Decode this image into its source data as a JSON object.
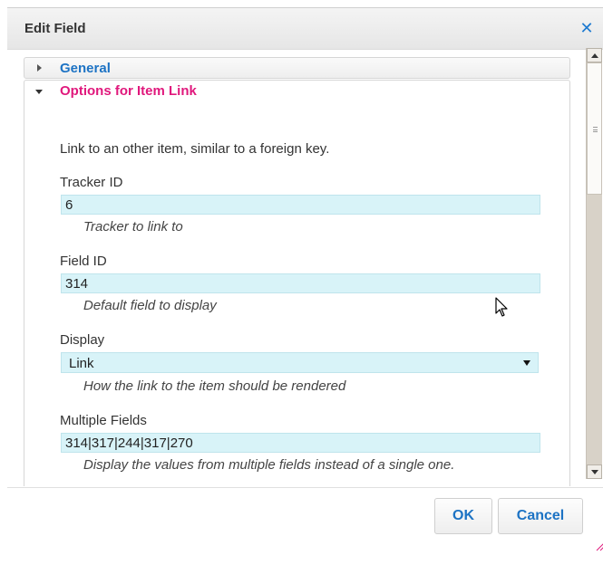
{
  "dialog": {
    "title": "Edit Field",
    "close_icon": "close-icon"
  },
  "sections": {
    "general_label": "General",
    "options_label": "Options for Item Link"
  },
  "options": {
    "description": "Link to an other item, similar to a foreign key.",
    "tracker_id": {
      "label": "Tracker ID",
      "value": "6",
      "help": "Tracker to link to"
    },
    "field_id": {
      "label": "Field ID",
      "value": "314",
      "help": "Default field to display"
    },
    "display": {
      "label": "Display",
      "selected": "Link",
      "help": "How the link to the item should be rendered"
    },
    "multiple_fields": {
      "label": "Multiple Fields",
      "value": "314|317|244|317|270",
      "help": "Display the values from multiple fields instead of a single one."
    }
  },
  "footer": {
    "ok_label": "OK",
    "cancel_label": "Cancel"
  },
  "colors": {
    "accent_blue": "#1d73c4",
    "accent_pink": "#e0187c",
    "input_bg": "#d8f3f8"
  }
}
